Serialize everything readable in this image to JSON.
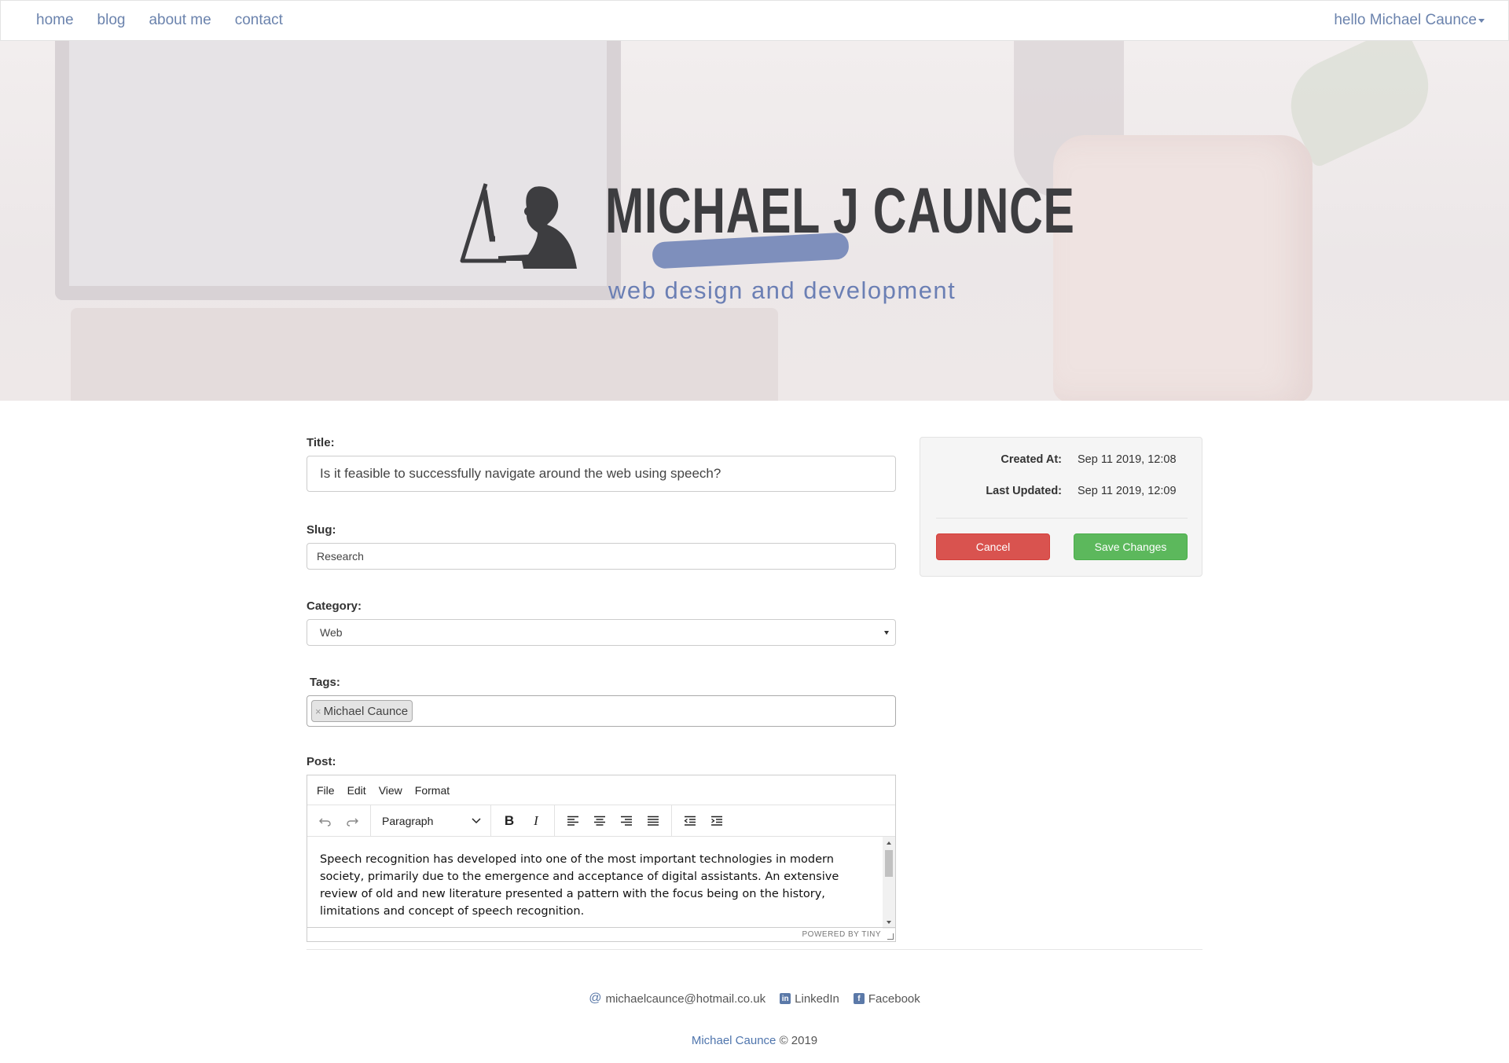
{
  "nav": {
    "links": [
      "home",
      "blog",
      "about me",
      "contact"
    ],
    "user_greeting": "hello Michael Caunce"
  },
  "hero": {
    "logo_name": "MICHAEL J CAUNCE",
    "logo_tagline": "web design and development"
  },
  "form": {
    "title_label": "Title:",
    "title_value": "Is it feasible to successfully navigate around the web using speech?",
    "slug_label": "Slug:",
    "slug_value": "Research",
    "category_label": "Category:",
    "category_value": "Web",
    "tags_label": "Tags:",
    "tags": [
      "Michael Caunce"
    ],
    "tag_remove_symbol": "×",
    "post_label": "Post:"
  },
  "editor": {
    "menu": [
      "File",
      "Edit",
      "View",
      "Format"
    ],
    "block_format": "Paragraph",
    "content": "Speech recognition has developed into one of the most important technologies in modern society, primarily due to the emergence and acceptance of digital assistants. An extensive review of old and new literature presented a pattern with the focus being on the history, limitations and concept of speech recognition.",
    "status": "POWERED BY TINY"
  },
  "side": {
    "created_label": "Created At:",
    "created_value": "Sep 11 2019, 12:08",
    "updated_label": "Last Updated:",
    "updated_value": "Sep 11 2019, 12:09",
    "cancel_label": "Cancel",
    "save_label": "Save Changes"
  },
  "footer": {
    "email": "michaelcaunce@hotmail.co.uk",
    "linkedin": "LinkedIn",
    "facebook": "Facebook",
    "copyright_name": "Michael Caunce",
    "copyright_rest": "© 2019"
  },
  "colors": {
    "nav_link": "#6b83ad",
    "cancel": "#d9534f",
    "save": "#5cb85c",
    "logo_accent": "#6b7fb4"
  }
}
